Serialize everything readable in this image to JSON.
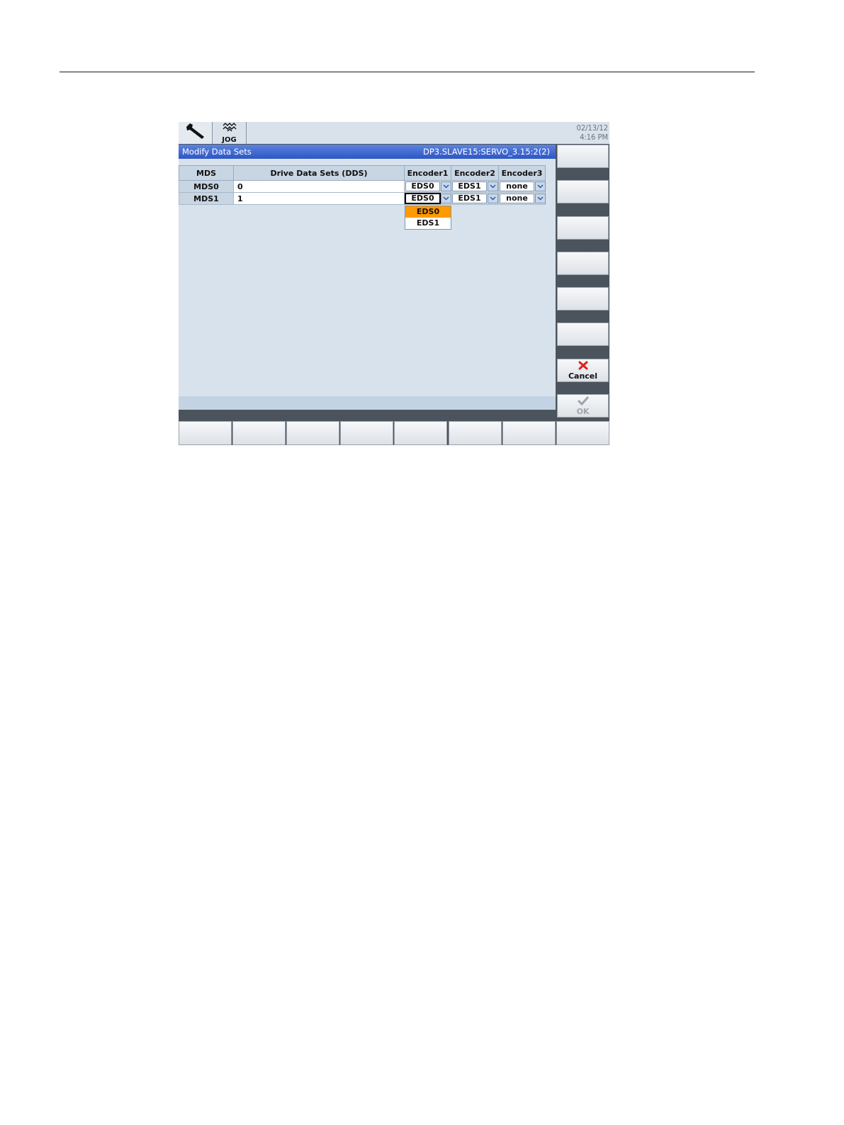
{
  "header": {
    "wrench_icon": "wrench-icon",
    "jog_label": "JOG",
    "date": "02/13/12",
    "time": "4:16 PM"
  },
  "window": {
    "title": "Modify Data Sets",
    "drive_object": "DP3.SLAVE15:SERVO_3.15:2(2)"
  },
  "table": {
    "headers": {
      "mds": "MDS",
      "dds": "Drive Data Sets (DDS)",
      "encoder1": "Encoder1",
      "encoder2": "Encoder2",
      "encoder3": "Encoder3"
    },
    "rows": [
      {
        "mds": "MDS0",
        "dds": "0",
        "encoder1": "EDS0",
        "encoder2": "EDS1",
        "encoder3": "none"
      },
      {
        "mds": "MDS1",
        "dds": "1",
        "encoder1": "EDS0",
        "encoder2": "EDS1",
        "encoder3": "none"
      }
    ]
  },
  "dropdown": {
    "options": [
      "EDS0",
      "EDS1"
    ],
    "selected": "EDS0"
  },
  "softkeys": {
    "cancel_label": "Cancel",
    "ok_label": "OK"
  },
  "colors": {
    "titlebar": "#3a63cc",
    "highlight": "#ff9a00",
    "cancel_icon": "#e0201a"
  }
}
